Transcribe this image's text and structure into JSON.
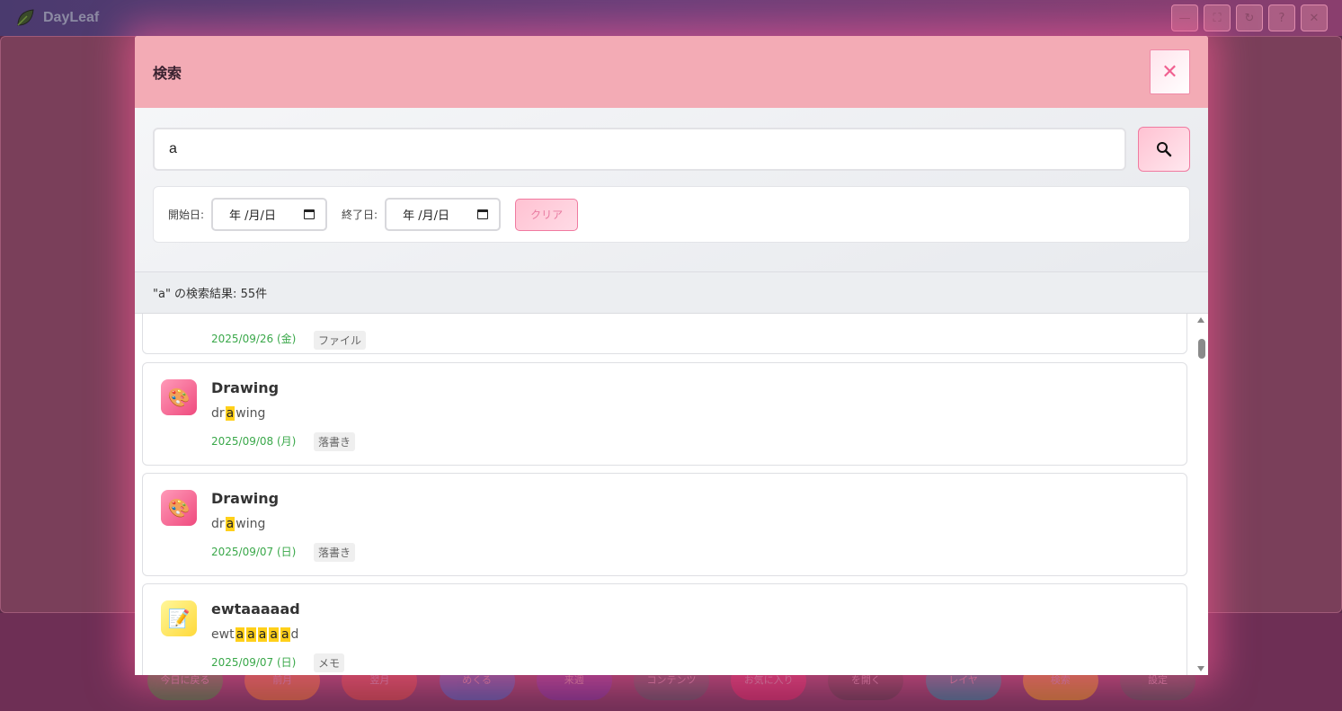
{
  "app": {
    "title": "DayLeaf",
    "window_controls": [
      "—",
      "⛶",
      "↻",
      "?",
      "✕"
    ]
  },
  "toolbar_buttons": [
    {
      "label": "今日に戻る",
      "color": "#3a7a3a"
    },
    {
      "label": "前月",
      "color": "#d06a2a"
    },
    {
      "label": "翌月",
      "color": "#c0403a"
    },
    {
      "label": "めくる",
      "color": "#3a5ab0"
    },
    {
      "label": "来週",
      "color": "#6a2a90"
    },
    {
      "label": "コンテンツ",
      "color": "#4a4a58"
    },
    {
      "label": "お気に入り",
      "color": "#c0205a"
    },
    {
      "label": "を開く",
      "color": "#4a3040"
    },
    {
      "label": "レイヤ",
      "color": "#1a7a90"
    },
    {
      "label": "検索",
      "color": "#d08a1a"
    },
    {
      "label": "設定",
      "color": "#4a4a50"
    }
  ],
  "modal": {
    "title": "検索",
    "close_label": "✕",
    "search": {
      "value": "a",
      "placeholder": ""
    },
    "filters": {
      "start_label": "開始日:",
      "end_label": "終了日:",
      "date_placeholder": "年 /月/日",
      "clear_label": "クリア"
    },
    "result_summary": "\"a\" の検索結果: 55件",
    "results": [
      {
        "title": "",
        "snippet": [],
        "date": "2025/09/26 (金)",
        "tag": "ファイル",
        "icon": "file-icon"
      },
      {
        "title": "Drawing",
        "snippet": [
          {
            "t": "dr",
            "h": false
          },
          {
            "t": "a",
            "h": true
          },
          {
            "t": "wing",
            "h": false
          }
        ],
        "date": "2025/09/08 (月)",
        "tag": "落書き",
        "icon": "palette-icon"
      },
      {
        "title": "Drawing",
        "snippet": [
          {
            "t": "dr",
            "h": false
          },
          {
            "t": "a",
            "h": true
          },
          {
            "t": "wing",
            "h": false
          }
        ],
        "date": "2025/09/07 (日)",
        "tag": "落書き",
        "icon": "palette-icon"
      },
      {
        "title": "ewtaaaaad",
        "snippet": [
          {
            "t": "ewt",
            "h": false
          },
          {
            "t": "a",
            "h": true
          },
          {
            "t": "a",
            "h": true
          },
          {
            "t": "a",
            "h": true
          },
          {
            "t": "a",
            "h": true
          },
          {
            "t": "a",
            "h": true
          },
          {
            "t": "d",
            "h": false
          }
        ],
        "date": "2025/09/07 (日)",
        "tag": "メモ",
        "icon": "memo-icon"
      }
    ]
  }
}
